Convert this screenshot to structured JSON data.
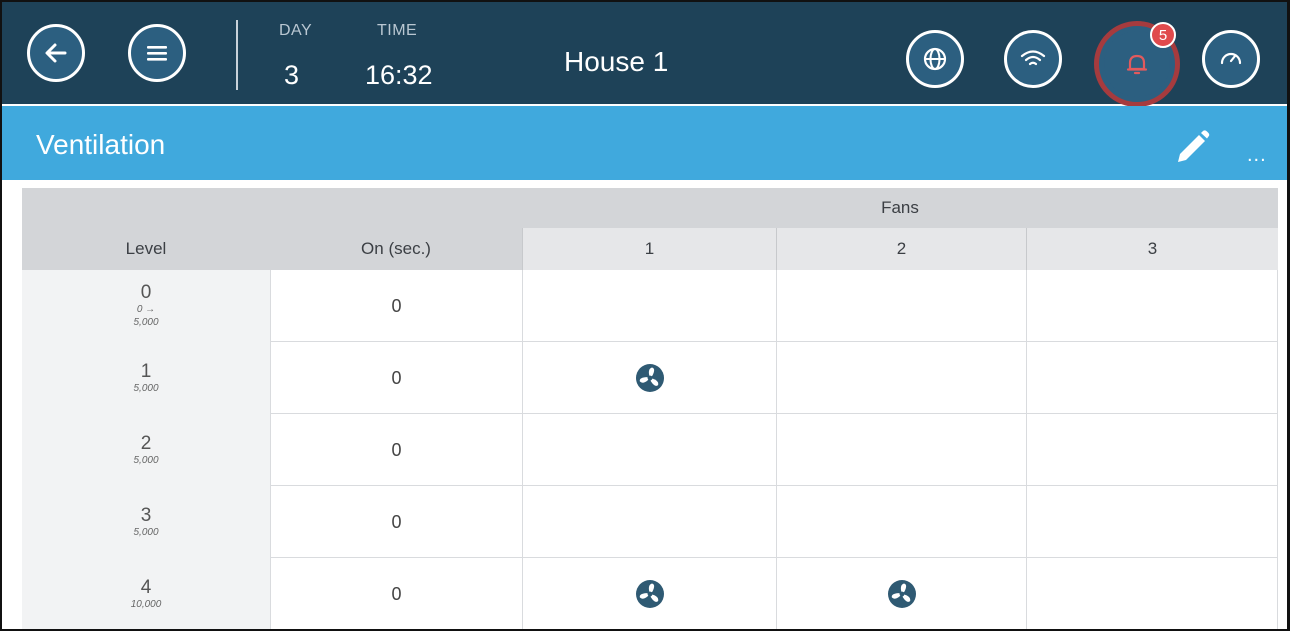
{
  "header": {
    "day_label": "DAY",
    "day_value": "3",
    "time_label": "TIME",
    "time_value": "16:32",
    "house_title": "House 1",
    "alarm_count": "5"
  },
  "icons": {
    "back": "arrow-left-icon",
    "menu": "hamburger-menu-icon",
    "globe": "globe-icon",
    "wifi": "wifi-icon",
    "alarm": "bell-icon",
    "gauge": "gauge-icon",
    "edit": "pencil-icon",
    "more": "more-dots-icon",
    "fan": "fan-icon"
  },
  "colors": {
    "topbar": "#1e4258",
    "button": "#2c5f80",
    "section": "#40a9dd",
    "alarm_ring": "#a63b3e",
    "badge": "#e04a4d",
    "fan": "#2f5a73"
  },
  "section": {
    "title": "Ventilation",
    "more_label": "..."
  },
  "table": {
    "group_header": "Fans",
    "columns": {
      "level": "Level",
      "on": "On (sec.)",
      "fans": [
        "1",
        "2",
        "3"
      ]
    },
    "rows": [
      {
        "level": "0",
        "arrow": "0 →",
        "target": "5,000",
        "on": "0",
        "fans": [
          false,
          false,
          false
        ]
      },
      {
        "level": "1",
        "arrow": "",
        "target": "5,000",
        "on": "0",
        "fans": [
          true,
          false,
          false
        ]
      },
      {
        "level": "2",
        "arrow": "",
        "target": "5,000",
        "on": "0",
        "fans": [
          false,
          false,
          false
        ]
      },
      {
        "level": "3",
        "arrow": "",
        "target": "5,000",
        "on": "0",
        "fans": [
          false,
          false,
          false
        ]
      },
      {
        "level": "4",
        "arrow": "",
        "target": "10,000",
        "on": "0",
        "fans": [
          true,
          true,
          false
        ]
      }
    ]
  }
}
